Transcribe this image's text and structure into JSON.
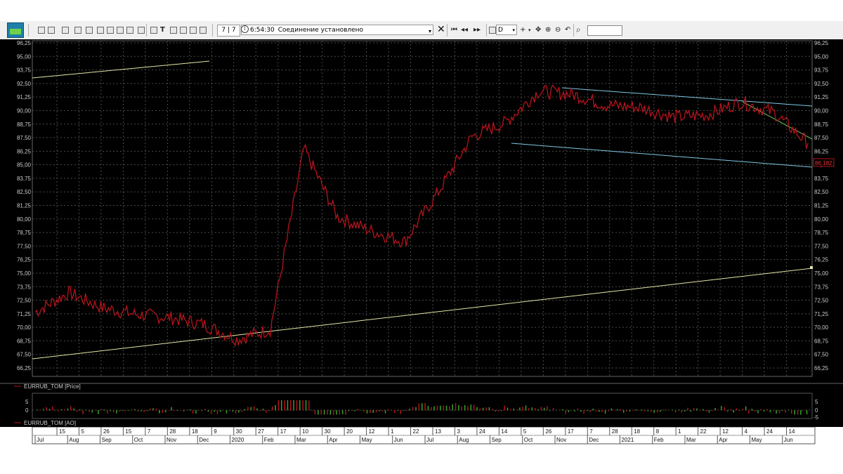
{
  "toolbar": {
    "counter": "7 | 7",
    "time": "6:54:30",
    "status": "Соединение установлено",
    "period": "D"
  },
  "price_axis_ticks": [
    "96,25",
    "95,00",
    "93,75",
    "92,50",
    "91,25",
    "90,00",
    "88,75",
    "87,50",
    "86,25",
    "85,00",
    "83,75",
    "82,50",
    "81,25",
    "80,00",
    "78,75",
    "77,50",
    "76,25",
    "75,00",
    "73,75",
    "72,50",
    "71,25",
    "70,00",
    "68,75",
    "67,50",
    "66,25"
  ],
  "ao_axis_ticks": [
    "5",
    "0",
    "-5"
  ],
  "date_axis": {
    "days": [
      "15",
      "5",
      "26",
      "15",
      "7",
      "28",
      "18",
      "9",
      "30",
      "27",
      "17",
      "10",
      "30",
      "20",
      "12",
      "1",
      "22",
      "13",
      "3",
      "24",
      "14",
      "5",
      "26",
      "17",
      "7",
      "28",
      "18",
      "8",
      "1",
      "22",
      "12",
      "4",
      "24",
      "14"
    ],
    "months": [
      "Jul",
      "Aug",
      "Sep",
      "Oct",
      "Nov",
      "Dec",
      "2020",
      "Feb",
      "Mar",
      "Apr",
      "May",
      "Jun",
      "Jul",
      "Aug",
      "Sep",
      "Oct",
      "Nov",
      "Dec",
      "2021",
      "Feb",
      "Mar",
      "Apr",
      "May",
      "Jun"
    ]
  },
  "price_panel_label": "EURRUB_TOM [Price]",
  "ao_panel_label": "EURRUB_TOM [AO]",
  "last_price_label": "86,182",
  "colors": {
    "price_line": "#b3141c",
    "support_line": "#e6e6a8",
    "channel_line": "#7ec8e3",
    "trend_line": "#6bbf5a",
    "grid": "#4a4a4a",
    "ao_green": "#3aa02a",
    "ao_red": "#b3141c"
  },
  "chart_data": {
    "type": "line",
    "series": [
      {
        "name": "EURRUB_TOM [Price]",
        "x": [
          "Jul 2019",
          "Aug 2019",
          "Sep 2019",
          "Oct 2019",
          "Nov 2019",
          "Dec 2019",
          "Jan 2020",
          "Feb 2020",
          "Mar 2020",
          "Apr 2020",
          "May 2020",
          "Jun 2020",
          "Jul 2020",
          "Aug 2020",
          "Sep 2020",
          "Oct 2020",
          "Nov 2020",
          "Dec 2020",
          "Jan 2021",
          "Feb 2021",
          "Mar 2021",
          "Apr 2021",
          "May 2021",
          "Jun 2021"
        ],
        "values": [
          71.4,
          73.2,
          71.8,
          71.2,
          70.9,
          70.3,
          68.9,
          69.8,
          86.5,
          80.2,
          78.9,
          77.9,
          82.5,
          87.6,
          88.9,
          91.8,
          91.5,
          90.5,
          90.3,
          89.4,
          89.6,
          90.8,
          89.8,
          87.0
        ]
      }
    ],
    "ylim": [
      66.25,
      96.25
    ]
  }
}
